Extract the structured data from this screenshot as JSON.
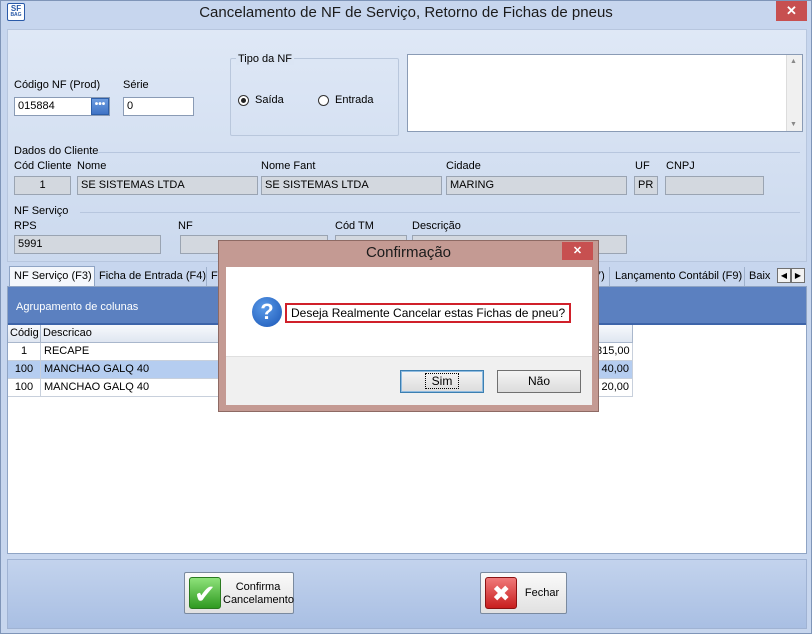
{
  "window": {
    "title": "Cancelamento de NF de Serviço, Retorno de Fichas de pneus",
    "app_icon_text": "SF",
    "app_icon_sub": "BAG",
    "close_glyph": "✕"
  },
  "header": {
    "codigo_nf_label": "Código NF (Prod)",
    "codigo_nf_value": "015884",
    "lookup_glyph": "•••",
    "serie_label": "Série",
    "serie_value": "0",
    "tipo_nf_label": "Tipo da NF",
    "radio_saida": "Saída",
    "radio_entrada": "Entrada"
  },
  "cliente": {
    "section_label": "Dados do Cliente",
    "cod_label": "Cód Cliente",
    "cod_value": "1",
    "nome_label": "Nome",
    "nome_value": "SE SISTEMAS LTDA",
    "nome_fant_label": "Nome Fant",
    "nome_fant_value": "SE SISTEMAS LTDA",
    "cidade_label": "Cidade",
    "cidade_value": "MARING",
    "uf_label": "UF",
    "uf_value": "PR",
    "cnpj_label": "CNPJ",
    "cnpj_value": ""
  },
  "nf_servico": {
    "section_label": "NF Serviço",
    "rps_label": "RPS",
    "rps_value": "5991",
    "nf_label": "NF",
    "nf_value": "",
    "cod_tm_label": "Cód TM",
    "descricao_label": "Descrição"
  },
  "tabs": [
    {
      "label": "NF Serviço (F3)"
    },
    {
      "label": "Ficha de Entrada (F4)"
    },
    {
      "label": "F"
    },
    {
      "label": "7)"
    },
    {
      "label": "Lançamento Contábil (F9)"
    },
    {
      "label": "Baix"
    }
  ],
  "grid": {
    "group_header": "Agrupamento de colunas",
    "columns": [
      "Códig",
      "Descricao"
    ],
    "rows": [
      {
        "codigo": "1",
        "descricao": "RECAPE",
        "valor": "315,00"
      },
      {
        "codigo": "100",
        "descricao": "MANCHAO GALQ 40",
        "valor": "40,00"
      },
      {
        "codigo": "100",
        "descricao": "MANCHAO GALQ 40",
        "valor": "20,00"
      }
    ]
  },
  "footer": {
    "confirma_label_line1": "Confirma",
    "confirma_label_line2": "Cancelamento",
    "fechar_label": "Fechar"
  },
  "dialog": {
    "title": "Confirmação",
    "close_glyph": "✕",
    "icon_glyph": "?",
    "message": "Deseja Realmente Cancelar estas Fichas de pneu?",
    "sim_label": "Sim",
    "nao_label": "Não"
  }
}
